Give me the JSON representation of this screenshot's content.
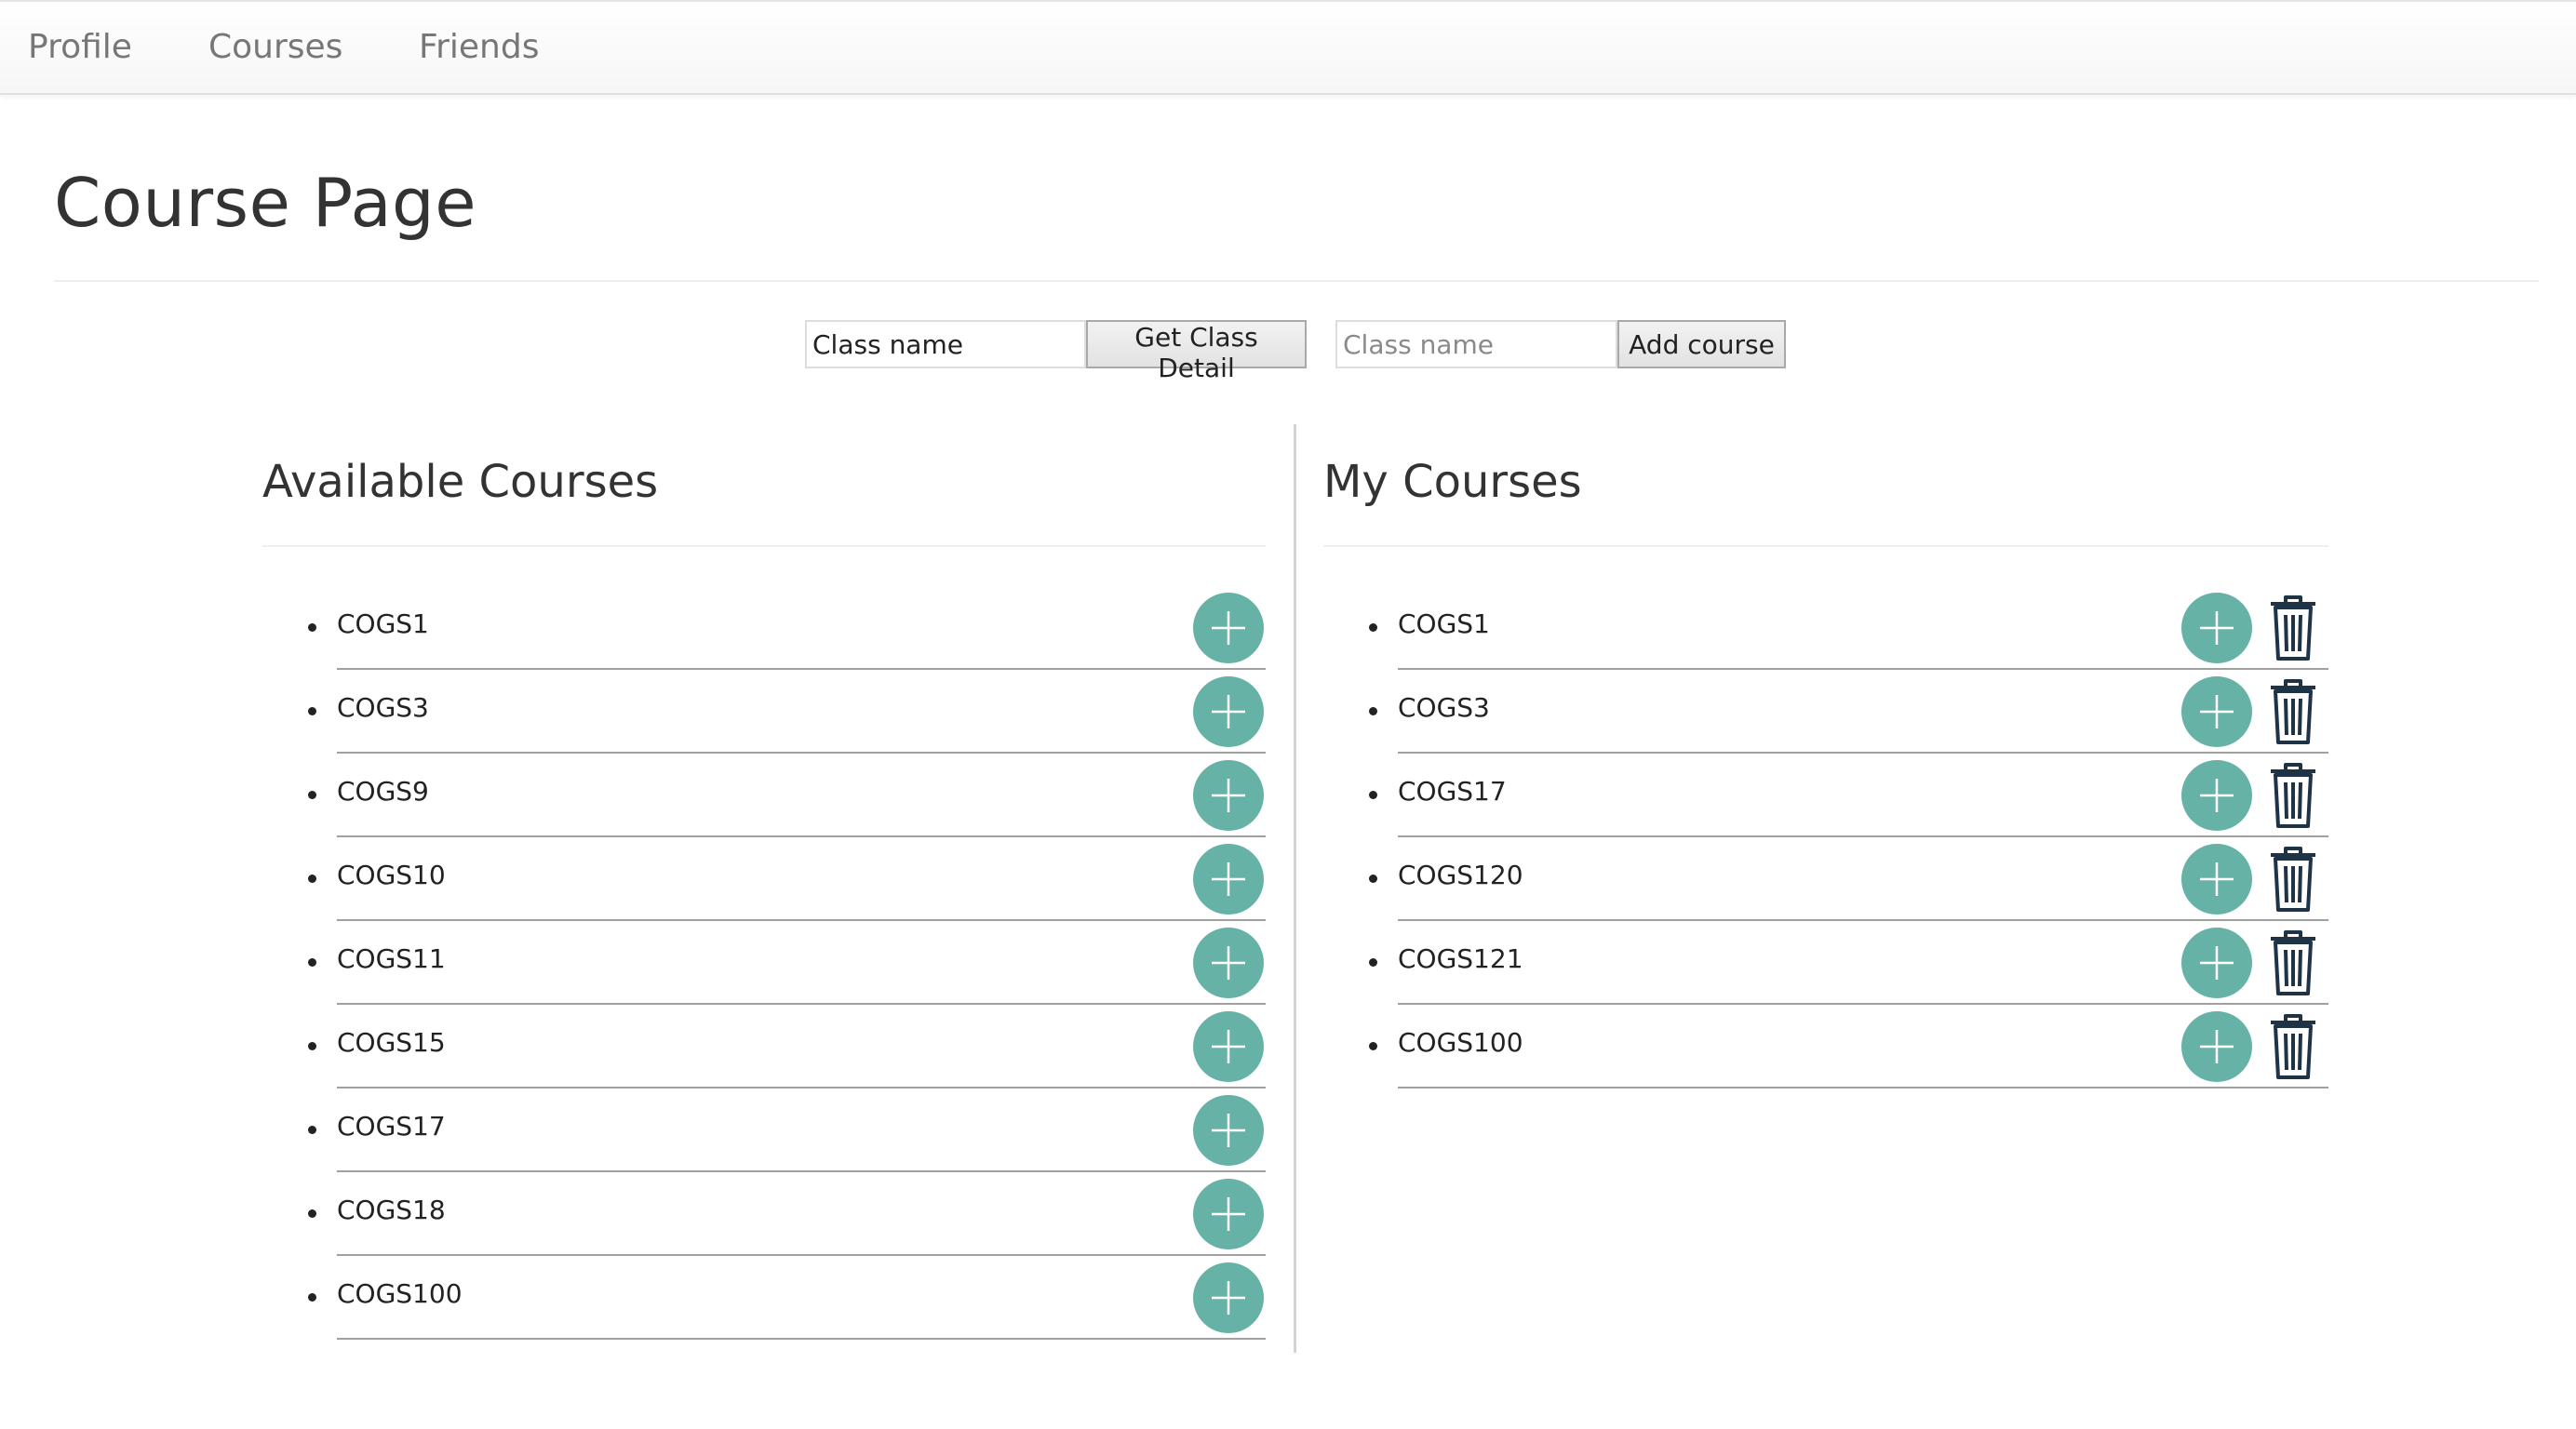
{
  "nav": {
    "links": [
      "Profile",
      "Courses",
      "Friends"
    ]
  },
  "page": {
    "title": "Course Page"
  },
  "toolbar": {
    "detail_input_value": "Class name",
    "detail_button_label": "Get Class Detail",
    "add_input_placeholder": "Class name",
    "add_button_label": "Add course"
  },
  "available": {
    "title": "Available Courses",
    "items": [
      "COGS1",
      "COGS3",
      "COGS9",
      "COGS10",
      "COGS11",
      "COGS15",
      "COGS17",
      "COGS18",
      "COGS100"
    ]
  },
  "mine": {
    "title": "My Courses",
    "items": [
      "COGS1",
      "COGS3",
      "COGS17",
      "COGS120",
      "COGS121",
      "COGS100"
    ]
  },
  "icons": {
    "add": "plus-circle-icon",
    "delete": "trash-icon"
  },
  "colors": {
    "accent": "#67b2a6",
    "trash": "#1f3346",
    "nav_text": "#777777"
  }
}
